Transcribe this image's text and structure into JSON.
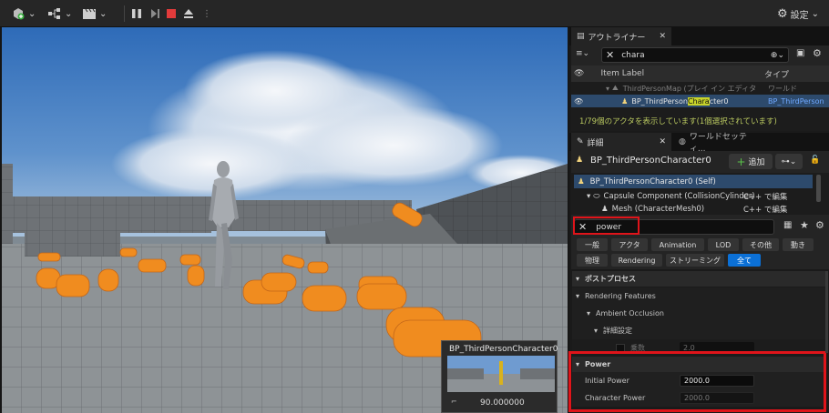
{
  "toolbar": {
    "settings_label": "設定"
  },
  "outliner": {
    "tab_label": "アウトライナー",
    "search_value": "chara",
    "col_item_label": "Item Label",
    "col_type": "タイプ",
    "rows": [
      {
        "label": "ThirdPersonMap (プレイ イン エディタ",
        "type": "ワールド"
      },
      {
        "label_before": "BP_ThirdPerson",
        "label_highlight": "Chara",
        "label_after": "cter0",
        "type": "BP_ThirdPerson"
      }
    ],
    "status": "1/79個のアクタを表示しています(1個選択されています)"
  },
  "details": {
    "tab_label": "詳細",
    "tab2_label": "ワールドセッティ...",
    "actor_name": "BP_ThirdPersonCharacter0",
    "add_label": "追加",
    "components": [
      {
        "label": "BP_ThirdPersonCharacter0 (Self)",
        "action": ""
      },
      {
        "label": "Capsule Component (CollisionCylinder)",
        "action": "C++ で編集"
      },
      {
        "label": "Mesh (CharacterMesh0)",
        "action": "C++ で編集"
      }
    ],
    "search_value": "power",
    "filters_row1": [
      "一般",
      "アクタ",
      "Animation",
      "LOD",
      "その他",
      "動き"
    ],
    "filters_row2": [
      "物理",
      "Rendering",
      "ストリーミング",
      "全て"
    ],
    "sections": {
      "post_process": "ポストプロセス",
      "rendering_features": "Rendering Features",
      "ambient_occlusion": "Ambient Occlusion",
      "advanced": "詳細設定",
      "intensity_label": "乗数",
      "intensity_value": "2.0",
      "power": "Power",
      "initial_power_label": "Initial Power",
      "initial_power_value": "2000.0",
      "character_power_label": "Character Power",
      "character_power_value": "2000.0"
    }
  },
  "preview": {
    "title": "BP_ThirdPersonCharacter0",
    "fov": "90.000000"
  },
  "colors": {
    "accent_blue": "#0b70d6",
    "highlight_red": "#e0141a",
    "orange_barrel": "#f08c1f",
    "select_row": "#2d4a6c"
  }
}
